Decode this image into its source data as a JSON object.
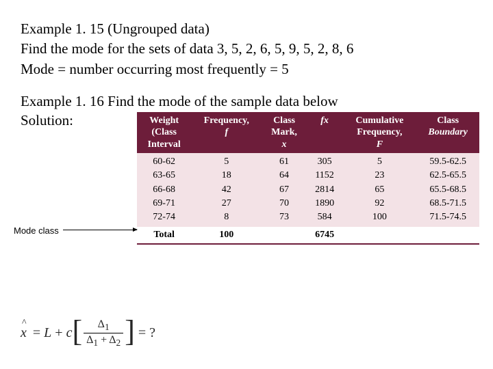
{
  "example115": {
    "title": "Example 1. 15 (Ungrouped data)",
    "prompt": "Find the mode for the sets of data  3,  5,  2,  6,  5,  9,  5,  2, 8,  6",
    "result": "Mode = number occurring most frequently = 5"
  },
  "example116": {
    "title": "Example 1. 16 Find the mode of the sample data below",
    "solution_label": "Solution:"
  },
  "mode_class_label": "Mode class",
  "table": {
    "headers": {
      "c0a": "Weight",
      "c0b": "(Class",
      "c0c": "Interval",
      "c1a": "Frequency,",
      "c1b": "f",
      "c2a": "Class",
      "c2b": "Mark,",
      "c2c": "x",
      "c3a": "fx",
      "c4a": "Cumulative",
      "c4b": "Frequency,",
      "c4c": "F",
      "c5a": "Class",
      "c5b": "Boundary"
    },
    "body": {
      "c0": "60-62\n63-65\n66-68\n69-71\n72-74",
      "c1": "5\n18\n42\n27\n8",
      "c2": "61\n64\n67\n70\n73",
      "c3": "305\n1152\n2814\n1890\n584",
      "c4": "5\n23\n65\n92\n100",
      "c5": "59.5-62.5\n62.5-65.5\n65.5-68.5\n68.5-71.5\n71.5-74.5"
    },
    "total": {
      "label": "Total",
      "f": "100",
      "fx": "6745"
    }
  },
  "formula": {
    "lhs": "x",
    "L": "L",
    "plus": "+",
    "c": "c",
    "d1": "Δ",
    "s1": "1",
    "d2": "Δ",
    "s2": "2",
    "tail": "= ?"
  }
}
